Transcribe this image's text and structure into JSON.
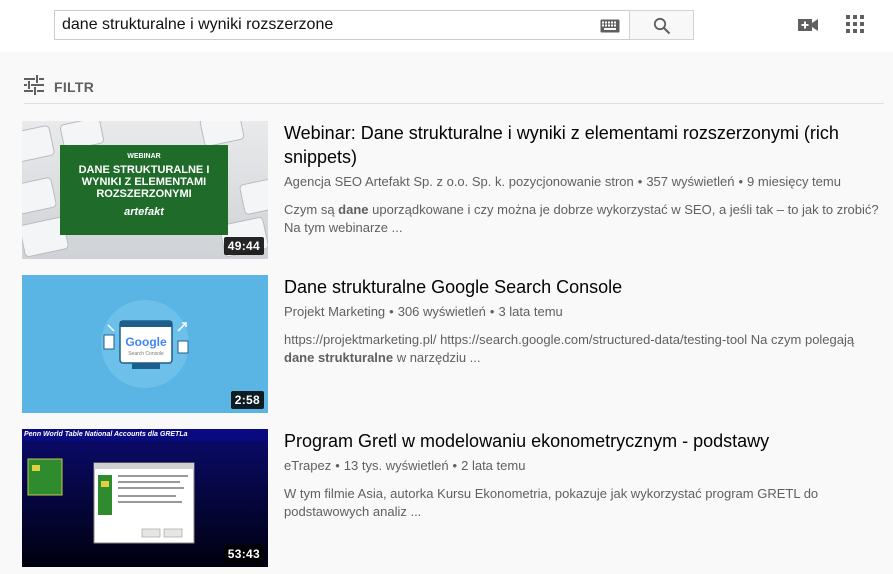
{
  "header": {
    "search_query": "dane strukturalne i wyniki rozszerzone",
    "keyboard_icon": "keyboard-icon",
    "search_icon": "search-icon",
    "create_icon": "video-camera-plus-icon",
    "apps_icon": "apps-grid-icon"
  },
  "filter": {
    "label": "FILTR",
    "icon": "sliders-icon"
  },
  "results": [
    {
      "title": "Webinar: Dane strukturalne i wyniki z elementami rozszerzonymi (rich snippets)",
      "channel": "Agencja SEO Artefakt Sp. z o.o. Sp. k. pozycjonowanie stron",
      "views": "357 wyświetleń",
      "age": "9 miesięcy temu",
      "desc_pre": "Czym są ",
      "desc_bold": "dane",
      "desc_post": " uporządkowane i czy można je dobrze wykorzystać w SEO, a jeśli tak – to jak to zrobić? Na tym webinarze ...",
      "duration": "49:44",
      "thumb": {
        "label": "WEBINAR",
        "line1": "DANE STRUKTURALNE I",
        "line2": "WYNIKI Z ELEMENTAMI",
        "line3": "ROZSZERZONYMI",
        "brand": "artefakt"
      }
    },
    {
      "title": "Dane strukturalne Google Search Console",
      "channel": "Projekt Marketing",
      "views": "306 wyświetleń",
      "age": "3 lata temu",
      "desc_pre": "https://projektmarketing.pl/ https://search.google.com/structured-data/testing-tool Na czym polegają ",
      "desc_bold": "dane strukturalne",
      "desc_post": " w narzędziu ...",
      "duration": "2:58",
      "thumb": {
        "logo": "Google",
        "sub": "Search Console"
      }
    },
    {
      "title": "Program Gretl w modelowaniu ekonometrycznym - podstawy",
      "channel": "eTrapez",
      "views": "13 tys. wyświetleń",
      "age": "2 lata temu",
      "desc_pre": "W tym filmie Asia, autorka Kursu Ekonometria, pokazuje jak wykorzystać program GRETL do podstawowych analiz ...",
      "desc_bold": "",
      "desc_post": "",
      "duration": "53:43",
      "thumb": {
        "caption": "Penn World Table National Accounts dla GRETLa"
      }
    }
  ]
}
